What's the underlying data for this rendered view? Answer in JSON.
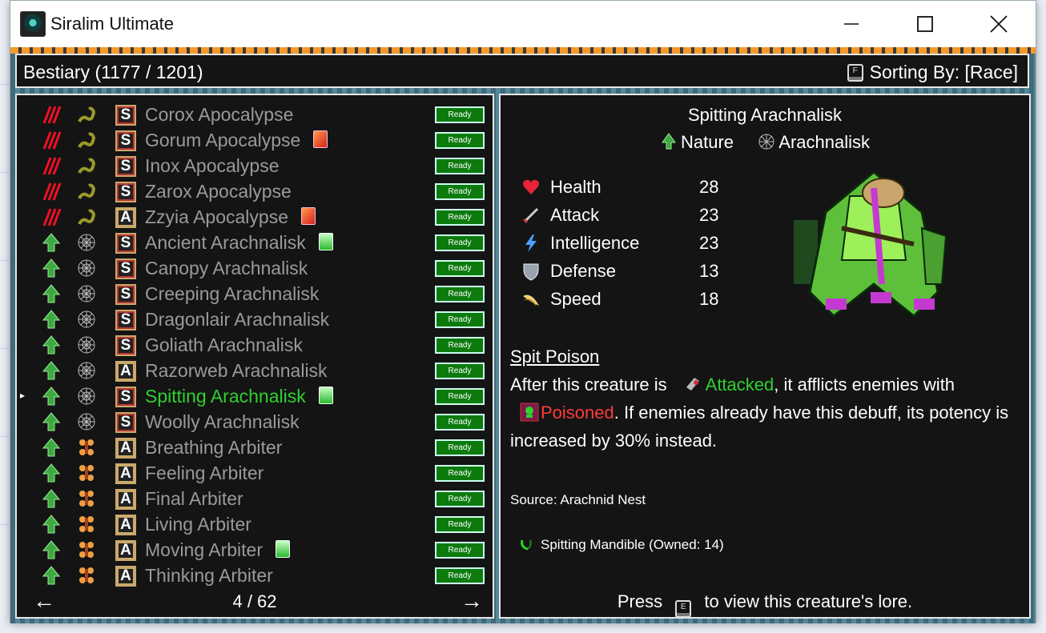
{
  "window": {
    "title": "Siralim Ultimate",
    "app_icon": "siralim-app-icon",
    "controls": [
      "minimize",
      "maximize",
      "close"
    ]
  },
  "header": {
    "title": "Bestiary (1177 / 1201)",
    "sort_key": "F",
    "sort_label": "Sorting By: [Race]"
  },
  "list": {
    "ready_label": "Ready",
    "items": [
      {
        "name": "Corox Apocalypse",
        "class": "S",
        "element": "chaos",
        "race": "apocalypse",
        "badge": null,
        "selected": false
      },
      {
        "name": "Gorum Apocalypse",
        "class": "S",
        "element": "chaos",
        "race": "apocalypse",
        "badge": "red",
        "selected": false
      },
      {
        "name": "Inox Apocalypse",
        "class": "S",
        "element": "chaos",
        "race": "apocalypse",
        "badge": null,
        "selected": false
      },
      {
        "name": "Zarox Apocalypse",
        "class": "S",
        "element": "chaos",
        "race": "apocalypse",
        "badge": null,
        "selected": false
      },
      {
        "name": "Zzyia Apocalypse",
        "class": "A",
        "element": "chaos",
        "race": "apocalypse",
        "badge": "red",
        "selected": false
      },
      {
        "name": "Ancient Arachnalisk",
        "class": "S",
        "element": "nature",
        "race": "arachnalisk",
        "badge": "green",
        "selected": false
      },
      {
        "name": "Canopy Arachnalisk",
        "class": "S",
        "element": "nature",
        "race": "arachnalisk",
        "badge": null,
        "selected": false
      },
      {
        "name": "Creeping Arachnalisk",
        "class": "S",
        "element": "nature",
        "race": "arachnalisk",
        "badge": null,
        "selected": false
      },
      {
        "name": "Dragonlair Arachnalisk",
        "class": "S",
        "element": "nature",
        "race": "arachnalisk",
        "badge": null,
        "selected": false
      },
      {
        "name": "Goliath Arachnalisk",
        "class": "S",
        "element": "nature",
        "race": "arachnalisk",
        "badge": null,
        "selected": false
      },
      {
        "name": "Razorweb Arachnalisk",
        "class": "A",
        "element": "nature",
        "race": "arachnalisk",
        "badge": null,
        "selected": false
      },
      {
        "name": "Spitting Arachnalisk",
        "class": "S",
        "element": "nature",
        "race": "arachnalisk",
        "badge": "green",
        "selected": true
      },
      {
        "name": "Woolly Arachnalisk",
        "class": "S",
        "element": "nature",
        "race": "arachnalisk",
        "badge": null,
        "selected": false
      },
      {
        "name": "Breathing Arbiter",
        "class": "A",
        "element": "nature",
        "race": "arbiter",
        "badge": null,
        "selected": false
      },
      {
        "name": "Feeling Arbiter",
        "class": "A",
        "element": "nature",
        "race": "arbiter",
        "badge": null,
        "selected": false
      },
      {
        "name": "Final Arbiter",
        "class": "A",
        "element": "nature",
        "race": "arbiter",
        "badge": null,
        "selected": false
      },
      {
        "name": "Living Arbiter",
        "class": "A",
        "element": "nature",
        "race": "arbiter",
        "badge": null,
        "selected": false
      },
      {
        "name": "Moving Arbiter",
        "class": "A",
        "element": "nature",
        "race": "arbiter",
        "badge": "green",
        "selected": false
      },
      {
        "name": "Thinking Arbiter",
        "class": "A",
        "element": "nature",
        "race": "arbiter",
        "badge": null,
        "selected": false
      }
    ],
    "page": "4 / 62"
  },
  "creature": {
    "name": "Spitting Arachnalisk",
    "element": "Nature",
    "race": "Arachnalisk",
    "stats": [
      {
        "label": "Health",
        "value": "28",
        "icon": "heart-icon"
      },
      {
        "label": "Attack",
        "value": "23",
        "icon": "sword-icon"
      },
      {
        "label": "Intelligence",
        "value": "23",
        "icon": "lightning-icon"
      },
      {
        "label": "Defense",
        "value": "13",
        "icon": "shield-icon"
      },
      {
        "label": "Speed",
        "value": "18",
        "icon": "wing-icon"
      }
    ],
    "trait_name": "Spit Poison",
    "trait_text_1": "After this creature is",
    "trait_kw_1": "Attacked",
    "trait_text_2": ", it afflicts enemies with",
    "trait_kw_2": "Poisoned",
    "trait_text_3": ". If enemies already have this debuff, its potency is increased by 30% instead.",
    "source": "Source: Arachnid Nest",
    "material": "Spitting Mandible (Owned: 14)",
    "lore_pre": "Press",
    "lore_key": "E",
    "lore_post": "to view this creature's lore."
  },
  "colors": {
    "selected_name": "#2fd12f",
    "ready_bg": "#0d7a0d",
    "poisoned": "#ff3a3a",
    "panel_bg": "#141414"
  }
}
